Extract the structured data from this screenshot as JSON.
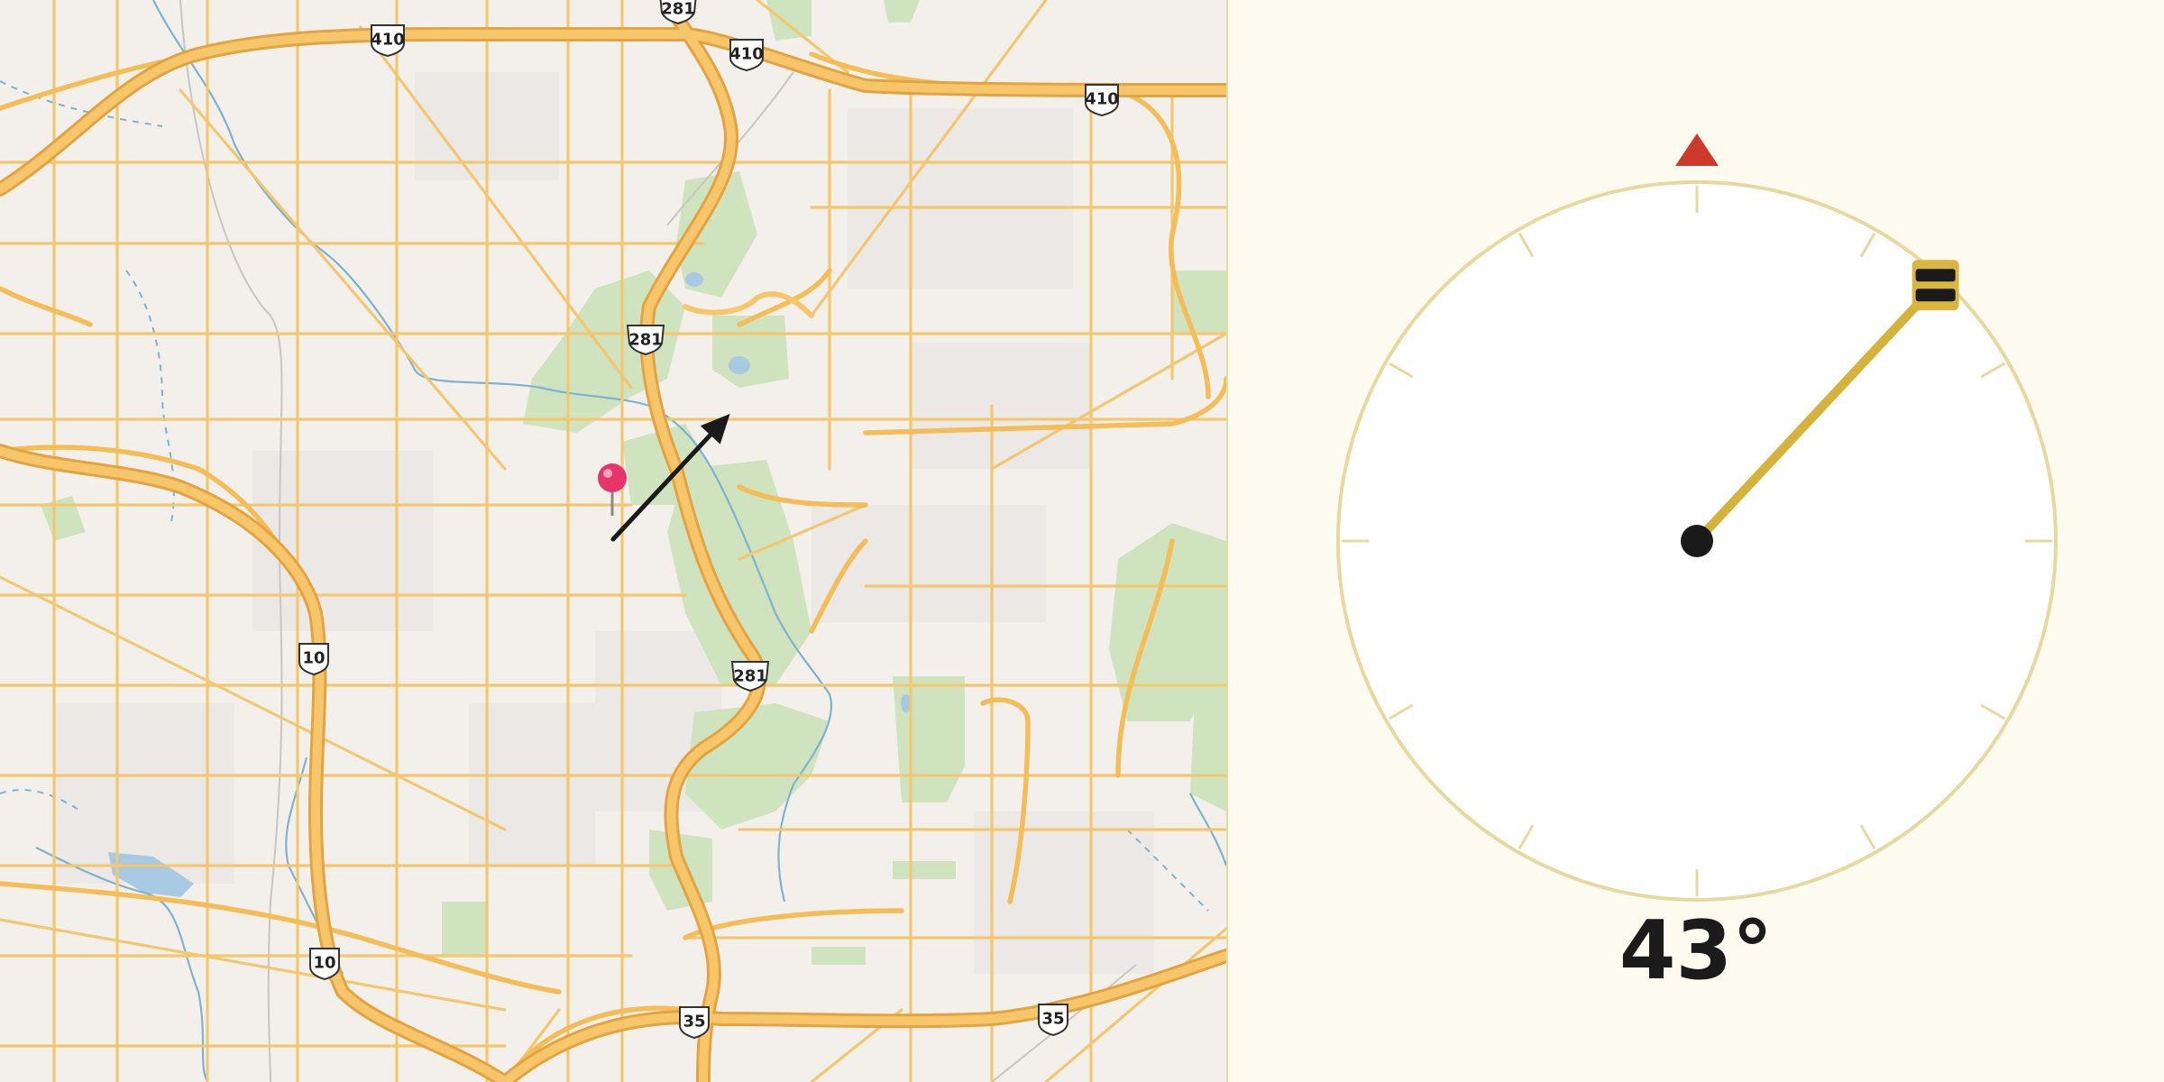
{
  "map": {
    "highway_shields": [
      {
        "label": "410",
        "kind": "interstate"
      },
      {
        "label": "410",
        "kind": "interstate"
      },
      {
        "label": "410",
        "kind": "interstate"
      },
      {
        "label": "281",
        "kind": "us-route"
      },
      {
        "label": "281",
        "kind": "us-route"
      },
      {
        "label": "281",
        "kind": "us-route"
      },
      {
        "label": "10",
        "kind": "interstate"
      },
      {
        "label": "10",
        "kind": "interstate"
      },
      {
        "label": "35",
        "kind": "interstate"
      },
      {
        "label": "35",
        "kind": "interstate"
      }
    ],
    "pin_color": "#e8336b",
    "arrow_color": "#1a1a1a",
    "arrow_heading_deg": 43
  },
  "compass": {
    "heading_deg": 43,
    "angle_text": "43°",
    "north_marker_color": "#cc3a2b",
    "needle_color": "#d4b23c",
    "dial_color": "#e6d9a0"
  }
}
